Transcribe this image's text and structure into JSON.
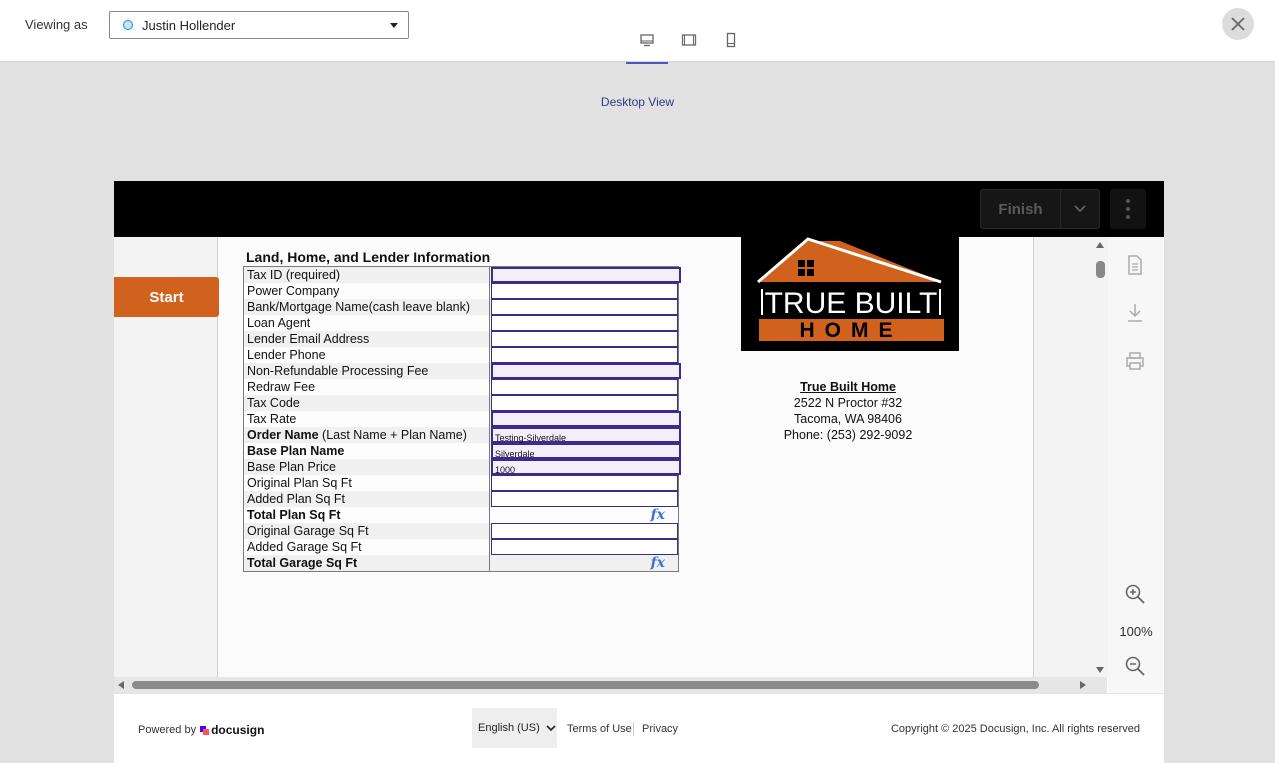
{
  "topbar": {
    "viewing_label": "Viewing as",
    "viewer_name": "Justin Hollender",
    "view_caption": "Desktop View"
  },
  "header": {
    "finish_label": "Finish"
  },
  "start_label": "Start",
  "zoom": {
    "level": "100%"
  },
  "form": {
    "title": "Land, Home, and Lender Information",
    "rows": [
      {
        "label": "Tax ID (required)",
        "bold": "",
        "value": ""
      },
      {
        "label": "Power Company",
        "bold": "",
        "value": ""
      },
      {
        "label": "Bank/Mortgage Name(cash leave blank)",
        "bold": "",
        "value": ""
      },
      {
        "label": "Loan Agent",
        "bold": "",
        "value": ""
      },
      {
        "label": "Lender Email Address",
        "bold": "",
        "value": ""
      },
      {
        "label": "Lender Phone",
        "bold": "",
        "value": ""
      },
      {
        "label": "Non-Refundable Processing Fee",
        "bold": "",
        "value": ""
      },
      {
        "label": "Redraw Fee",
        "bold": "",
        "value": ""
      },
      {
        "label": "Tax Code",
        "bold": "",
        "value": ""
      },
      {
        "label": "Tax Rate",
        "bold": "",
        "value": ""
      },
      {
        "label": " (Last Name + Plan Name)",
        "bold": "Order Name",
        "value": "Testing-Silverdale"
      },
      {
        "label": "",
        "bold": "Base Plan Name",
        "value": "Silverdale"
      },
      {
        "label": "Base Plan Price",
        "bold": "",
        "value": "1000"
      },
      {
        "label": "Original Plan Sq Ft",
        "bold": "",
        "value": ""
      },
      {
        "label": "Added Plan Sq Ft",
        "bold": "",
        "value": ""
      },
      {
        "label": "",
        "bold": "Total Plan Sq Ft",
        "value": "",
        "fx": "fx"
      },
      {
        "label": "Original Garage Sq Ft",
        "bold": "",
        "value": ""
      },
      {
        "label": "Added Garage Sq Ft",
        "bold": "",
        "value": ""
      },
      {
        "label": "",
        "bold": "Total Garage Sq Ft",
        "value": "",
        "fx": "fx"
      }
    ]
  },
  "logo": {
    "line1": "TRUE BUILT",
    "line2": "HOME",
    "colors": {
      "roof": "#d0621d",
      "band": "#d0621d"
    }
  },
  "company": {
    "name": "True Built Home",
    "address1": "2522 N Proctor #32",
    "address2": "Tacoma, WA 98406",
    "phone": "Phone: (253) 292-9092"
  },
  "footer": {
    "powered_by": "Powered by",
    "brand": "docusign",
    "language": "English (US)",
    "terms": "Terms of Use",
    "privacy": "Privacy",
    "copyright": "Copyright © 2025 Docusign, Inc. All rights reserved"
  },
  "colors": {
    "accent": "#d0621d",
    "field_border": "#3d2a8c",
    "tab_active": "#4c56c6"
  },
  "icons": [
    "desktop-icon",
    "tablet-icon",
    "mobile-icon",
    "close-icon",
    "chevron-down-icon",
    "kebab-menu-icon",
    "document-icon",
    "download-icon",
    "print-icon",
    "zoom-in-icon",
    "zoom-out-icon"
  ]
}
